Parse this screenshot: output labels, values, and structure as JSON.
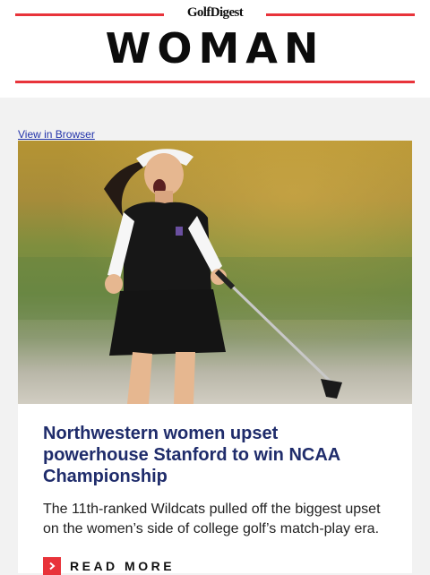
{
  "header": {
    "brand": "GolfDigest",
    "title": "WOMAN"
  },
  "view_in_browser": "View in Browser",
  "article": {
    "hero_image": "golfer-celebrating-photo",
    "headline": "Northwestern women upset powerhouse Stanford to win NCAA Championship",
    "dek": "The 11th-ranked Wildcats pulled off the biggest upset on the women’s side of college golf’s match-play era.",
    "cta_label": "READ MORE",
    "cta_icon": "chevron-right-icon"
  },
  "colors": {
    "accent": "#e8333a",
    "headline": "#1f2c6b",
    "link": "#2233aa",
    "page_bg": "#f2f2f2"
  }
}
